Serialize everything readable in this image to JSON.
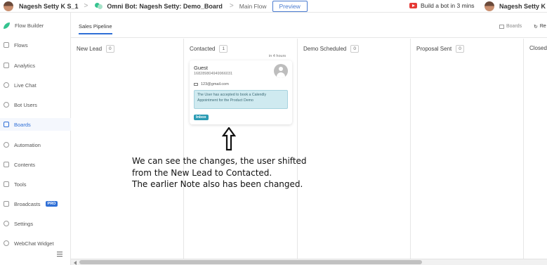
{
  "topbar": {
    "user_name": "Nagesh Setty K S_1",
    "separator": ">",
    "bot_name": "Omni Bot: Nagesh Setty: Demo_Board",
    "flow_label": "Main Flow",
    "preview_label": "Preview",
    "youtube_label": "Build a bot in 3 mins",
    "user_name_right": "Nagesh Setty K S"
  },
  "sidebar": {
    "items": [
      {
        "label": "Flow Builder",
        "icon": "leaf-icon"
      },
      {
        "label": "Flows",
        "icon": "flows-icon"
      },
      {
        "label": "Analytics",
        "icon": "analytics-icon"
      },
      {
        "label": "Live Chat",
        "icon": "live-chat-icon"
      },
      {
        "label": "Bot Users",
        "icon": "user-icon"
      },
      {
        "label": "Boards",
        "icon": "boards-icon",
        "active": true
      },
      {
        "label": "Automation",
        "icon": "gear-icon"
      },
      {
        "label": "Contents",
        "icon": "contents-icon"
      },
      {
        "label": "Tools",
        "icon": "tools-icon"
      },
      {
        "label": "Broadcasts",
        "icon": "broadcast-icon",
        "badge": "PRO"
      },
      {
        "label": "Settings",
        "icon": "settings-icon"
      },
      {
        "label": "WebChat Widget",
        "icon": "webchat-icon"
      }
    ]
  },
  "tabs": {
    "active_tab": "Sales Pipeline",
    "boards_link": "Boards",
    "refresh_link": "Re"
  },
  "columns": [
    {
      "title": "New Lead",
      "count": "0"
    },
    {
      "title": "Contacted",
      "count": "1"
    },
    {
      "title": "Demo Scheduled",
      "count": "0"
    },
    {
      "title": "Proposal Sent",
      "count": "0"
    },
    {
      "title": "Closed",
      "count": ""
    }
  ],
  "card": {
    "name": "Guest",
    "id": "168289804949966031",
    "email": "123@gmail.com",
    "note": "The User has accepted to book a Calendly Appointment for the Product Demo",
    "badge": "Inbox",
    "time": "in 4 hours"
  },
  "annotation": {
    "line1": "We can see the changes, the user shifted",
    "line2": "from the New Lead to Contacted.",
    "line3": "The earlier Note also has been changed."
  },
  "colors": {
    "accent": "#2f6fd6",
    "note_bg": "#cfeaf0",
    "badge": "#2a9bb4",
    "brand_green": "#34c38f",
    "youtube": "#e53935"
  }
}
